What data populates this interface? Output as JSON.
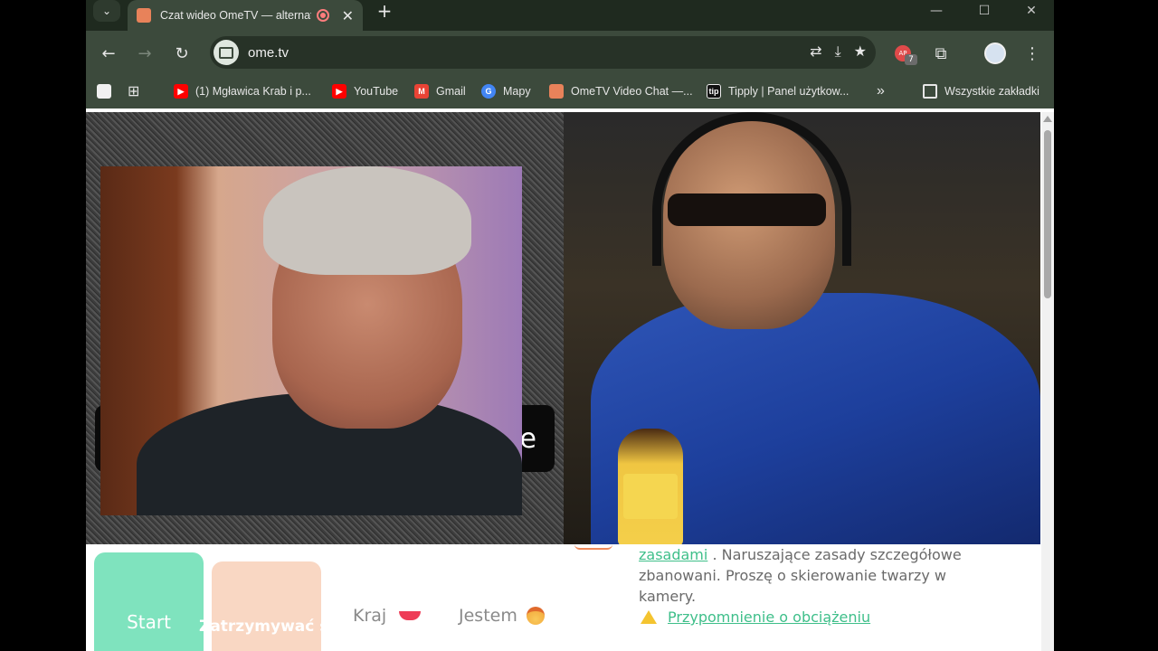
{
  "browser": {
    "tab": {
      "title": "Czat wideo OmeTV — alternat",
      "close": "✕"
    },
    "new_tab": "+",
    "window_controls": {
      "minimize": "—",
      "maximize": "☐",
      "close": "✕"
    },
    "toolbar": {
      "back": "←",
      "forward": "→",
      "reload": "↻",
      "url": "ome.tv",
      "extension_count": "7"
    },
    "bookmarks": [
      {
        "label": "(1) Mgławica Krab i p...",
        "icon": "youtube-icon"
      },
      {
        "label": "YouTube",
        "icon": "youtube-icon"
      },
      {
        "label": "Gmail",
        "icon": "gmail-icon"
      },
      {
        "label": "Mapy",
        "icon": "google-icon"
      },
      {
        "label": "OmeTV Video Chat —...",
        "icon": "ometv-icon"
      },
      {
        "label": "Tipply | Panel użytkow...",
        "icon": "tipply-icon"
      }
    ],
    "bookmarks_overflow": "»",
    "all_bookmarks": "Wszystkie zakładki"
  },
  "page": {
    "left_banner_text": "e",
    "start_button": "Start",
    "stop_button": "Zatrzymywać się",
    "country_filter": "Kraj",
    "gender_filter": "Jestem",
    "info": {
      "rules_link": "zasadami",
      "rules_text": ". Naruszające zasady szczegółowe zbanowani. Proszę o skierowanie twarzy w kamery.",
      "reminder_link": "Przypomnienie o obciążeniu"
    }
  },
  "colors": {
    "start": "#7fe3be",
    "stop": "#f9d7c3",
    "link": "#3fbf8a",
    "browser_chrome": "#3c4a3c"
  }
}
